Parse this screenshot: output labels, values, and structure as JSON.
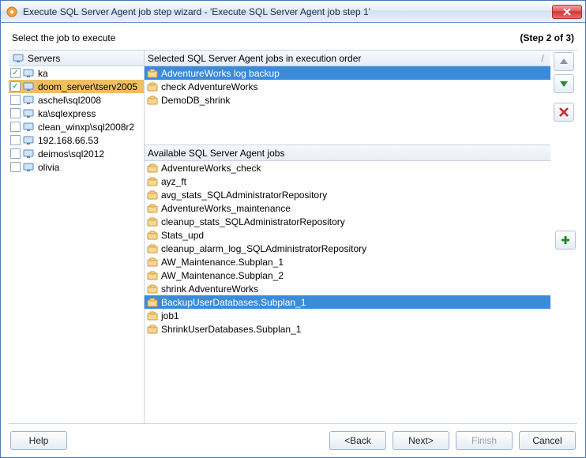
{
  "window": {
    "title": "Execute SQL Server Agent job step wizard - 'Execute SQL Server Agent job step 1'"
  },
  "header": {
    "prompt": "Select the job to execute",
    "step": "(Step 2 of 3)"
  },
  "servers": {
    "col_label": "Servers",
    "items": [
      {
        "name": "ka",
        "checked": true,
        "selected": false
      },
      {
        "name": "doom_server\\tserv2005",
        "checked": true,
        "selected": true
      },
      {
        "name": "aschel\\sql2008",
        "checked": false,
        "selected": false
      },
      {
        "name": "ka\\sqlexpress",
        "checked": false,
        "selected": false
      },
      {
        "name": "clean_winxp\\sql2008r2",
        "checked": false,
        "selected": false
      },
      {
        "name": "192.168.66.53",
        "checked": false,
        "selected": false
      },
      {
        "name": "deimos\\sql2012",
        "checked": false,
        "selected": false
      },
      {
        "name": "olivia",
        "checked": false,
        "selected": false
      }
    ]
  },
  "selected_jobs": {
    "header": "Selected SQL Server Agent jobs in execution order",
    "slash": "/",
    "items": [
      {
        "name": "AdventureWorks log backup",
        "selected": true
      },
      {
        "name": "check AdventureWorks",
        "selected": false
      },
      {
        "name": "DemoDB_shrink",
        "selected": false
      }
    ]
  },
  "available_jobs": {
    "header": "Available SQL Server Agent jobs",
    "items": [
      {
        "name": "AdventureWorks_check",
        "selected": false
      },
      {
        "name": "ayz_ft",
        "selected": false
      },
      {
        "name": "avg_stats_SQLAdministratorRepository",
        "selected": false
      },
      {
        "name": "AdventureWorks_maintenance",
        "selected": false
      },
      {
        "name": "cleanup_stats_SQLAdministratorRepository",
        "selected": false
      },
      {
        "name": "Stats_upd",
        "selected": false
      },
      {
        "name": "cleanup_alarm_log_SQLAdministratorRepository",
        "selected": false
      },
      {
        "name": "AW_Maintenance.Subplan_1",
        "selected": false
      },
      {
        "name": "AW_Maintenance.Subplan_2",
        "selected": false
      },
      {
        "name": "shrink AdventureWorks",
        "selected": false
      },
      {
        "name": "BackupUserDatabases.Subplan_1",
        "selected": true
      },
      {
        "name": "job1",
        "selected": false
      },
      {
        "name": "ShrinkUserDatabases.Subplan_1",
        "selected": false
      }
    ]
  },
  "buttons": {
    "help": "Help",
    "back": "<Back",
    "next": "Next>",
    "finish": "Finish",
    "cancel": "Cancel"
  }
}
